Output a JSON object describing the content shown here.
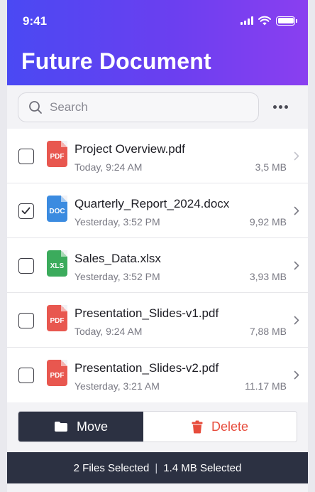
{
  "status_bar": {
    "time": "9:41"
  },
  "header": {
    "title": "Future Document"
  },
  "search": {
    "placeholder": "Search"
  },
  "files": [
    {
      "name": "Project Overview.pdf",
      "date": "Today, 9:24 AM",
      "size": "3,5 MB",
      "type_label": "PDF",
      "type_color": "#e8574f",
      "checked": false
    },
    {
      "name": "Quarterly_Report_2024.docx",
      "date": "Yesterday, 3:52 PM",
      "size": "9,92 MB",
      "type_label": "DOC",
      "type_color": "#3b8be0",
      "checked": true
    },
    {
      "name": "Sales_Data.xlsx",
      "date": "Yesterday, 3:52 PM",
      "size": "3,93 MB",
      "type_label": "XLS",
      "type_color": "#3bab5c",
      "checked": false
    },
    {
      "name": "Presentation_Slides-v1.pdf",
      "date": "Today, 9:24 AM",
      "size": "7,88 MB",
      "type_label": "PDF",
      "type_color": "#e8574f",
      "checked": false
    },
    {
      "name": "Presentation_Slides-v2.pdf",
      "date": "Yesterday, 3:21 AM",
      "size": "11.17 MB",
      "type_label": "PDF",
      "type_color": "#e8574f",
      "checked": false
    }
  ],
  "actions": {
    "move_label": "Move",
    "delete_label": "Delete"
  },
  "footer": {
    "files_selected": "2 Files Selected",
    "separator": "|",
    "size_selected": "1.4 MB Selected"
  },
  "colors": {
    "header_start": "#4a49f3",
    "header_end": "#8a3ff0",
    "dark": "#2c3142",
    "delete": "#e74c3c"
  },
  "icons": [
    "signal-icon",
    "wifi-icon",
    "battery-icon",
    "search-icon",
    "more-icon",
    "chevron-right-icon",
    "folder-icon",
    "trash-icon",
    "checkmark-icon"
  ]
}
